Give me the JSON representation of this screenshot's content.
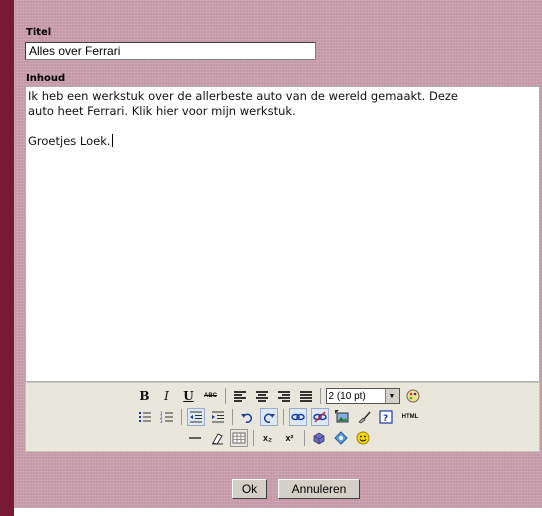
{
  "form": {
    "titel_label": "Titel",
    "titel_value": "Alles over Ferrari",
    "inhoud_label": "Inhoud",
    "content": {
      "line1": "Ik heb een werkstuk over de allerbeste auto van de wereld gemaakt. Deze",
      "line2": "auto heet Ferrari. Klik hier voor mijn werkstuk.",
      "line3": "Groetjes Loek."
    }
  },
  "toolbar": {
    "bold_label": "B",
    "italic_label": "I",
    "underline_label": "U",
    "strike_label": "ABC",
    "font_size_value": "2 (10 pt)",
    "html_label": "HTML",
    "sub_label": "x₂",
    "sup_label": "x²"
  },
  "buttons": {
    "ok_label": "Ok",
    "cancel_label": "Annuleren"
  },
  "colors": {
    "panel": "#c598a8",
    "left_bar": "#7a1838",
    "toolbar": "#e9e6dc"
  }
}
